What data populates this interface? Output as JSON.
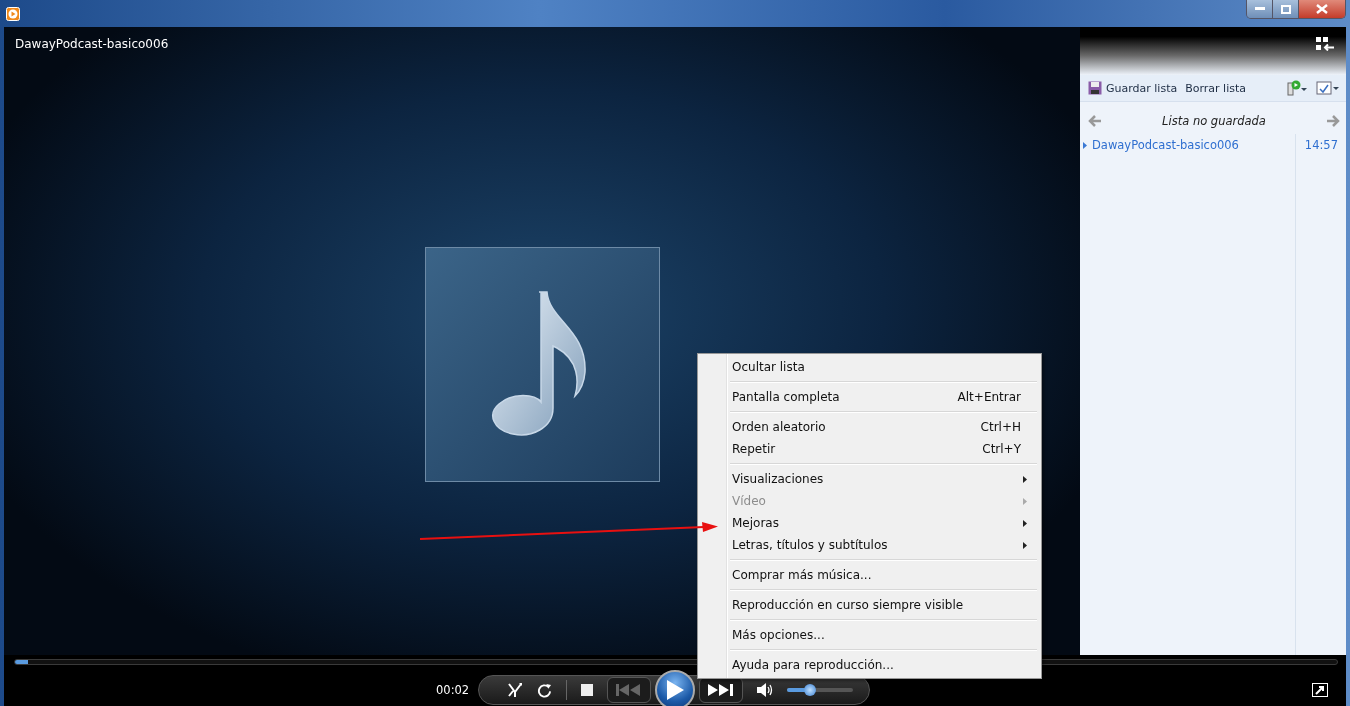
{
  "window": {
    "title": "DawayPodcast-basico006"
  },
  "playlist": {
    "toolbar": [
      "Guardar lista",
      "Borrar lista"
    ],
    "title": "Lista no guardada",
    "items": [
      {
        "title": "DawayPodcast-basico006",
        "duration": "14:57",
        "playing": true
      }
    ]
  },
  "player": {
    "time": "00:02",
    "seek": {
      "level": 0.01
    },
    "volume": {
      "level": 0.35
    }
  },
  "context_menu": {
    "groups": [
      [
        {
          "label": "Ocultar lista",
          "submenu": false,
          "disabled": false
        }
      ],
      [
        {
          "label": "Pantalla completa",
          "shortcut": "Alt+Entrar",
          "submenu": false,
          "disabled": false
        }
      ],
      [
        {
          "label": "Orden aleatorio",
          "shortcut": "Ctrl+H",
          "submenu": false,
          "disabled": false
        },
        {
          "label": "Repetir",
          "shortcut": "Ctrl+Y",
          "submenu": false,
          "disabled": false
        }
      ],
      [
        {
          "label": "Visualizaciones",
          "submenu": true,
          "disabled": false
        },
        {
          "label": "Vídeo",
          "submenu": true,
          "disabled": true
        },
        {
          "label": "Mejoras",
          "submenu": true,
          "disabled": false
        },
        {
          "label": "Letras, títulos y subtítulos",
          "submenu": true,
          "disabled": false
        }
      ],
      [
        {
          "label": "Comprar más música...",
          "submenu": false,
          "disabled": false
        }
      ],
      [
        {
          "label": "Reproducción en curso siempre visible",
          "submenu": false,
          "disabled": false
        }
      ],
      [
        {
          "label": "Más opciones...",
          "submenu": false,
          "disabled": false
        }
      ],
      [
        {
          "label": "Ayuda para reproducción...",
          "submenu": false,
          "disabled": false
        }
      ]
    ]
  }
}
